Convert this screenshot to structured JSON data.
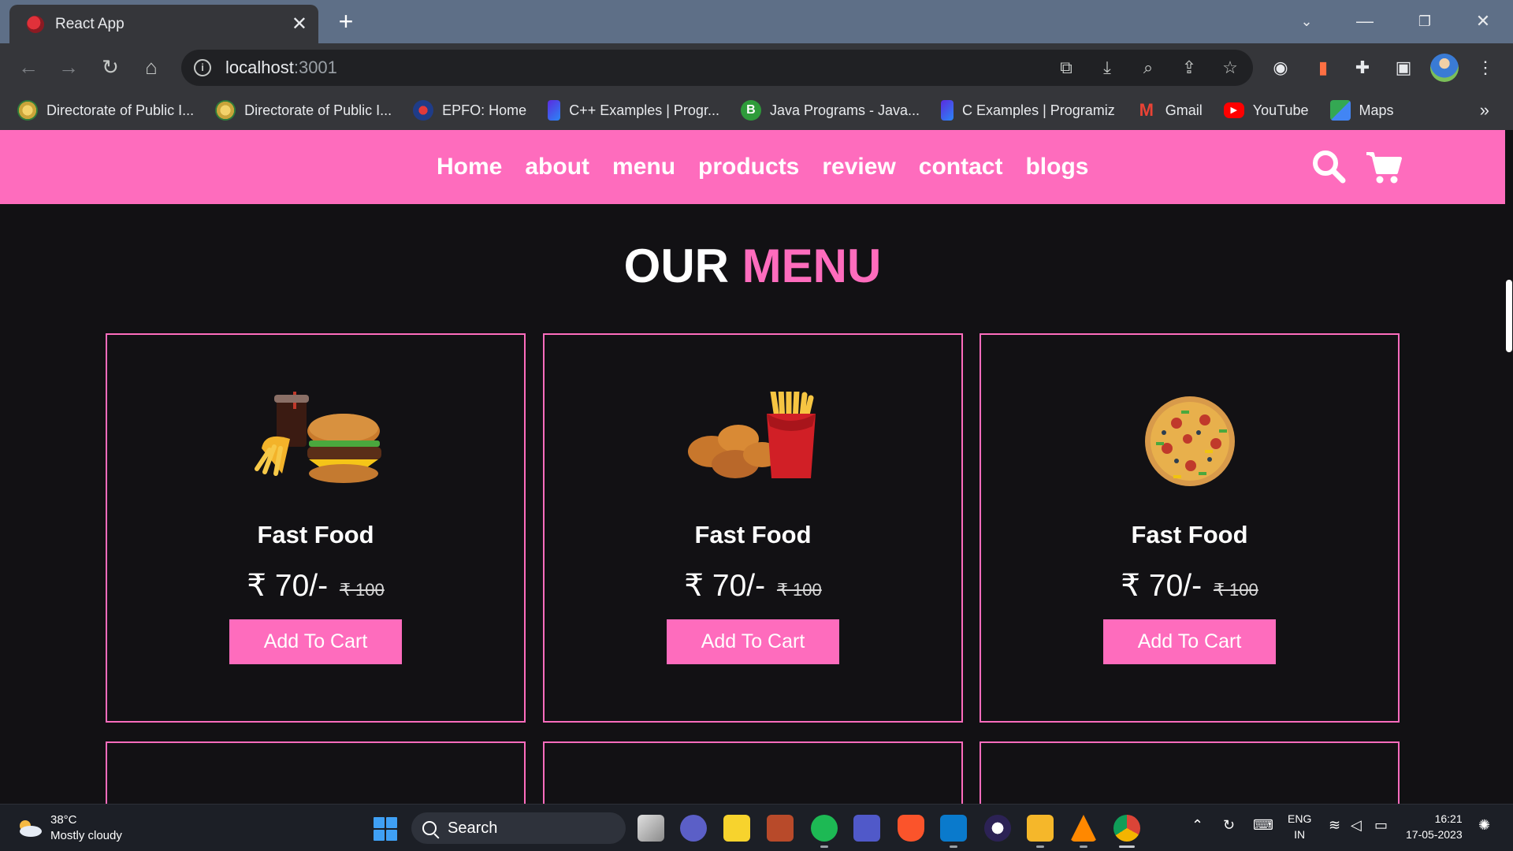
{
  "browser": {
    "tab_title": "React App",
    "tab_close": "✕",
    "new_tab": "+",
    "url_host": "localhost",
    "url_port": ":3001",
    "bookmarks": [
      {
        "label": "Directorate of Public I...",
        "icon": "emblem-icon",
        "color": "#c9a43a"
      },
      {
        "label": "Directorate of Public I...",
        "icon": "emblem-icon",
        "color": "#c9a43a"
      },
      {
        "label": "EPFO: Home",
        "icon": "epfo-icon",
        "color": "#1f3c88"
      },
      {
        "label": "C++ Examples | Progr...",
        "icon": "programiz-icon",
        "color": "#5b2be0"
      },
      {
        "label": "Java Programs - Java...",
        "icon": "beginnersbook-icon",
        "color": "#2e9b3a"
      },
      {
        "label": "C Examples | Programiz",
        "icon": "programiz-icon",
        "color": "#5b2be0"
      },
      {
        "label": "Gmail",
        "icon": "gmail-icon",
        "color": "#ea4335"
      },
      {
        "label": "YouTube",
        "icon": "youtube-icon",
        "color": "#ff0000"
      },
      {
        "label": "Maps",
        "icon": "maps-icon",
        "color": "#34a853"
      }
    ],
    "bookmarks_more": "»"
  },
  "site": {
    "nav": [
      "Home",
      "about",
      "menu",
      "products",
      "review",
      "contact",
      "blogs"
    ],
    "accent_color": "#fe6cbd",
    "section_title_a": "OUR",
    "section_title_b": "MENU",
    "cards": [
      {
        "name": "Fast Food",
        "price": "₹ 70/-",
        "old_price": "₹ 100",
        "button": "Add To Cart",
        "image": "burger-combo"
      },
      {
        "name": "Fast Food",
        "price": "₹ 70/-",
        "old_price": "₹ 100",
        "button": "Add To Cart",
        "image": "chicken-fries"
      },
      {
        "name": "Fast Food",
        "price": "₹ 70/-",
        "old_price": "₹ 100",
        "button": "Add To Cart",
        "image": "pizza"
      }
    ]
  },
  "taskbar": {
    "temperature": "38°C",
    "weather": "Mostly cloudy",
    "search": "Search",
    "lang_a": "ENG",
    "lang_b": "IN",
    "time": "16:21",
    "date": "17-05-2023"
  }
}
